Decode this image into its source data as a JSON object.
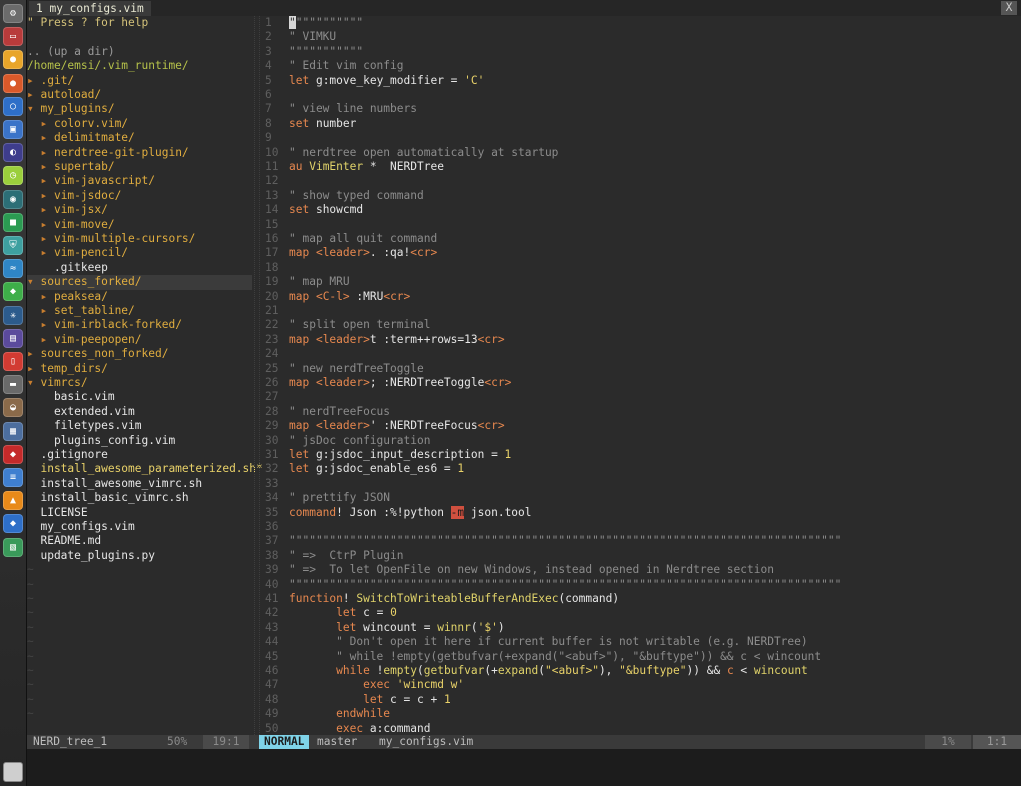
{
  "tab": {
    "label": "1  my_configs.vim",
    "close": "X"
  },
  "dock": {
    "items": [
      {
        "icon": "system-settings-icon",
        "color": "#6b6b6b",
        "glyph": "⚙"
      },
      {
        "icon": "terminal-icon",
        "color": "#b83b3b",
        "glyph": "▭"
      },
      {
        "icon": "chrome-icon",
        "color": "#e8a52a",
        "glyph": "●"
      },
      {
        "icon": "firefox-icon",
        "color": "#d9592a",
        "glyph": "●"
      },
      {
        "icon": "browser-icon",
        "color": "#2e6fc8",
        "glyph": "○"
      },
      {
        "icon": "network-icon",
        "color": "#3a73c8",
        "glyph": "▣"
      },
      {
        "icon": "eclipse-icon",
        "color": "#3e3d8c",
        "glyph": "◐"
      },
      {
        "icon": "clock-icon",
        "color": "#9bcf3c",
        "glyph": "◷"
      },
      {
        "icon": "camera-icon",
        "color": "#2c6e76",
        "glyph": "◉"
      },
      {
        "icon": "app-green-icon",
        "color": "#2b9b52",
        "glyph": "■"
      },
      {
        "icon": "shield-icon",
        "color": "#3ea0a0",
        "glyph": "⛨"
      },
      {
        "icon": "fish-icon",
        "color": "#2f86c6",
        "glyph": "≈"
      },
      {
        "icon": "android-icon",
        "color": "#3eae49",
        "glyph": "◆"
      },
      {
        "icon": "atom-icon",
        "color": "#2c5b8c",
        "glyph": "✳"
      },
      {
        "icon": "server-icon",
        "color": "#5b4a9c",
        "glyph": "▤"
      },
      {
        "icon": "document-icon",
        "color": "#d23b32",
        "glyph": "▯"
      },
      {
        "icon": "drive-icon",
        "color": "#6a6a6a",
        "glyph": "▬"
      },
      {
        "icon": "disk-icon",
        "color": "#8a6a4a",
        "glyph": "◒"
      },
      {
        "icon": "monitor-icon",
        "color": "#4c6e9e",
        "glyph": "▦"
      },
      {
        "icon": "ruby-icon",
        "color": "#c42a2a",
        "glyph": "◆"
      },
      {
        "icon": "text-editor-icon",
        "color": "#3f7fd0",
        "glyph": "≡"
      },
      {
        "icon": "vlc-icon",
        "color": "#e88a1a",
        "glyph": "▲"
      },
      {
        "icon": "vpn-icon",
        "color": "#2e6fc8",
        "glyph": "◆"
      },
      {
        "icon": "image-viewer-icon",
        "color": "#3a9a5a",
        "glyph": "▧"
      }
    ],
    "trash_icon": "trash-icon"
  },
  "tree": [
    {
      "s": [
        {
          "c": "help",
          "t": "\" Press ? for help"
        }
      ]
    },
    {
      "s": []
    },
    {
      "s": [
        {
          "c": "dim",
          "t": ".. (up a dir)"
        }
      ]
    },
    {
      "s": [
        {
          "c": "cwd",
          "t": "/home/emsi/.vim_runtime/"
        }
      ]
    },
    {
      "s": [
        {
          "c": "arrow",
          "t": "▸ "
        },
        {
          "c": "dir",
          "t": ".git/"
        }
      ]
    },
    {
      "s": [
        {
          "c": "arrow",
          "t": "▸ "
        },
        {
          "c": "dir",
          "t": "autoload/"
        }
      ]
    },
    {
      "s": [
        {
          "c": "arrow",
          "t": "▾ "
        },
        {
          "c": "dir",
          "t": "my_plugins/"
        }
      ]
    },
    {
      "s": [
        {
          "c": "arrow",
          "t": "  ▸ "
        },
        {
          "c": "dir",
          "t": "colorv.vim/"
        }
      ]
    },
    {
      "s": [
        {
          "c": "arrow",
          "t": "  ▸ "
        },
        {
          "c": "dir",
          "t": "delimitmate/"
        }
      ]
    },
    {
      "s": [
        {
          "c": "arrow",
          "t": "  ▸ "
        },
        {
          "c": "dir",
          "t": "nerdtree-git-plugin/"
        }
      ]
    },
    {
      "s": [
        {
          "c": "arrow",
          "t": "  ▸ "
        },
        {
          "c": "dir",
          "t": "supertab/"
        }
      ]
    },
    {
      "s": [
        {
          "c": "arrow",
          "t": "  ▸ "
        },
        {
          "c": "dir",
          "t": "vim-javascript/"
        }
      ]
    },
    {
      "s": [
        {
          "c": "arrow",
          "t": "  ▸ "
        },
        {
          "c": "dir",
          "t": "vim-jsdoc/"
        }
      ]
    },
    {
      "s": [
        {
          "c": "arrow",
          "t": "  ▸ "
        },
        {
          "c": "dir",
          "t": "vim-jsx/"
        }
      ]
    },
    {
      "s": [
        {
          "c": "arrow",
          "t": "  ▸ "
        },
        {
          "c": "dir",
          "t": "vim-move/"
        }
      ]
    },
    {
      "s": [
        {
          "c": "arrow",
          "t": "  ▸ "
        },
        {
          "c": "dir",
          "t": "vim-multiple-cursors/"
        }
      ]
    },
    {
      "s": [
        {
          "c": "arrow",
          "t": "  ▸ "
        },
        {
          "c": "dir",
          "t": "vim-pencil/"
        }
      ]
    },
    {
      "s": [
        {
          "c": "file",
          "t": "    .gitkeep"
        }
      ]
    },
    {
      "hl": true,
      "s": [
        {
          "c": "arrow",
          "t": "▾ "
        },
        {
          "c": "dir",
          "t": "sources_forked/"
        }
      ]
    },
    {
      "s": [
        {
          "c": "arrow",
          "t": "  ▸ "
        },
        {
          "c": "dir",
          "t": "peaksea/"
        }
      ]
    },
    {
      "s": [
        {
          "c": "arrow",
          "t": "  ▸ "
        },
        {
          "c": "dir",
          "t": "set_tabline/"
        }
      ]
    },
    {
      "s": [
        {
          "c": "arrow",
          "t": "  ▸ "
        },
        {
          "c": "dir",
          "t": "vim-irblack-forked/"
        }
      ]
    },
    {
      "s": [
        {
          "c": "arrow",
          "t": "  ▸ "
        },
        {
          "c": "dir",
          "t": "vim-peepopen/"
        }
      ]
    },
    {
      "s": [
        {
          "c": "arrow",
          "t": "▸ "
        },
        {
          "c": "dir",
          "t": "sources_non_forked/"
        }
      ]
    },
    {
      "s": [
        {
          "c": "arrow",
          "t": "▸ "
        },
        {
          "c": "dir",
          "t": "temp_dirs/"
        }
      ]
    },
    {
      "s": [
        {
          "c": "arrow",
          "t": "▾ "
        },
        {
          "c": "dir",
          "t": "vimrcs/"
        }
      ]
    },
    {
      "s": [
        {
          "c": "file",
          "t": "    basic.vim"
        }
      ]
    },
    {
      "s": [
        {
          "c": "file",
          "t": "    extended.vim"
        }
      ]
    },
    {
      "s": [
        {
          "c": "file",
          "t": "    filetypes.vim"
        }
      ]
    },
    {
      "s": [
        {
          "c": "file",
          "t": "    plugins_config.vim"
        }
      ]
    },
    {
      "s": [
        {
          "c": "file",
          "t": "  .gitignore"
        }
      ]
    },
    {
      "s": [
        {
          "c": "str",
          "t": "  install_awesome_parameterized.sh*"
        }
      ]
    },
    {
      "s": [
        {
          "c": "file",
          "t": "  install_awesome_vimrc.sh"
        }
      ]
    },
    {
      "s": [
        {
          "c": "file",
          "t": "  install_basic_vimrc.sh"
        }
      ]
    },
    {
      "s": [
        {
          "c": "file",
          "t": "  LICENSE"
        }
      ]
    },
    {
      "s": [
        {
          "c": "file",
          "t": "  my_configs.vim"
        }
      ]
    },
    {
      "s": [
        {
          "c": "file",
          "t": "  README.md"
        }
      ]
    },
    {
      "s": [
        {
          "c": "file",
          "t": "  update_plugins.py"
        }
      ]
    },
    {
      "s": [
        {
          "c": "tilde",
          "t": "~"
        }
      ]
    },
    {
      "s": [
        {
          "c": "tilde",
          "t": "~"
        }
      ]
    },
    {
      "s": [
        {
          "c": "tilde",
          "t": "~"
        }
      ]
    },
    {
      "s": [
        {
          "c": "tilde",
          "t": "~"
        }
      ]
    },
    {
      "s": [
        {
          "c": "tilde",
          "t": "~"
        }
      ]
    },
    {
      "s": [
        {
          "c": "tilde",
          "t": "~"
        }
      ]
    },
    {
      "s": [
        {
          "c": "tilde",
          "t": "~"
        }
      ]
    },
    {
      "s": [
        {
          "c": "tilde",
          "t": "~"
        }
      ]
    },
    {
      "s": [
        {
          "c": "tilde",
          "t": "~"
        }
      ]
    },
    {
      "s": [
        {
          "c": "tilde",
          "t": "~"
        }
      ]
    },
    {
      "s": [
        {
          "c": "tilde",
          "t": "~"
        }
      ]
    }
  ],
  "editor": [
    {
      "n": "1",
      "s": [
        {
          "c": "cursor",
          "t": "\""
        },
        {
          "c": "comment",
          "t": "\"\"\"\"\"\"\"\"\"\""
        }
      ]
    },
    {
      "n": "2",
      "s": [
        {
          "c": "comment",
          "t": "\" VIMKU"
        }
      ]
    },
    {
      "n": "3",
      "s": [
        {
          "c": "comment",
          "t": "\"\"\"\"\"\"\"\"\"\"\""
        }
      ]
    },
    {
      "n": "4",
      "s": [
        {
          "c": "comment",
          "t": "\" Edit vim config"
        }
      ]
    },
    {
      "n": "5",
      "s": [
        {
          "c": "kw",
          "t": "let "
        },
        {
          "c": "id",
          "t": "g:move_key_modifier = "
        },
        {
          "c": "str",
          "t": "'C'"
        }
      ]
    },
    {
      "n": "6",
      "s": []
    },
    {
      "n": "7",
      "s": [
        {
          "c": "comment",
          "t": "\" view line numbers"
        }
      ]
    },
    {
      "n": "8",
      "s": [
        {
          "c": "kw",
          "t": "set "
        },
        {
          "c": "id",
          "t": "number"
        }
      ]
    },
    {
      "n": "9",
      "s": []
    },
    {
      "n": "10",
      "s": [
        {
          "c": "comment",
          "t": "\" nerdtree open automatically at startup"
        }
      ]
    },
    {
      "n": "11",
      "s": [
        {
          "c": "kw",
          "t": "au "
        },
        {
          "c": "cmd",
          "t": "VimEnter"
        },
        {
          "c": "id",
          "t": " *  NERDTree"
        }
      ]
    },
    {
      "n": "12",
      "s": []
    },
    {
      "n": "13",
      "s": [
        {
          "c": "comment",
          "t": "\" show typed command"
        }
      ]
    },
    {
      "n": "14",
      "s": [
        {
          "c": "kw",
          "t": "set "
        },
        {
          "c": "id",
          "t": "showcmd"
        }
      ]
    },
    {
      "n": "15",
      "s": []
    },
    {
      "n": "16",
      "s": [
        {
          "c": "comment",
          "t": "\" map all quit command"
        }
      ]
    },
    {
      "n": "17",
      "s": [
        {
          "c": "kw",
          "t": "map "
        },
        {
          "c": "kw",
          "t": "<leader>"
        },
        {
          "c": "id",
          "t": ". :qa!"
        },
        {
          "c": "kw",
          "t": "<cr>"
        }
      ]
    },
    {
      "n": "18",
      "s": []
    },
    {
      "n": "19",
      "s": [
        {
          "c": "comment",
          "t": "\" map MRU"
        }
      ]
    },
    {
      "n": "20",
      "s": [
        {
          "c": "kw",
          "t": "map "
        },
        {
          "c": "kw",
          "t": "<C-l>"
        },
        {
          "c": "id",
          "t": " :MRU"
        },
        {
          "c": "kw",
          "t": "<cr>"
        }
      ]
    },
    {
      "n": "21",
      "s": []
    },
    {
      "n": "22",
      "s": [
        {
          "c": "comment",
          "t": "\" split open terminal"
        }
      ]
    },
    {
      "n": "23",
      "s": [
        {
          "c": "kw",
          "t": "map "
        },
        {
          "c": "kw",
          "t": "<leader>"
        },
        {
          "c": "id",
          "t": "t :term++rows=13"
        },
        {
          "c": "kw",
          "t": "<cr>"
        }
      ]
    },
    {
      "n": "24",
      "s": []
    },
    {
      "n": "25",
      "s": [
        {
          "c": "comment",
          "t": "\" new nerdTreeToggle"
        }
      ]
    },
    {
      "n": "26",
      "s": [
        {
          "c": "kw",
          "t": "map "
        },
        {
          "c": "kw",
          "t": "<leader>"
        },
        {
          "c": "id",
          "t": "; :NERDTreeToggle"
        },
        {
          "c": "kw",
          "t": "<cr>"
        }
      ]
    },
    {
      "n": "27",
      "s": []
    },
    {
      "n": "28",
      "s": [
        {
          "c": "comment",
          "t": "\" nerdTreeFocus"
        }
      ]
    },
    {
      "n": "29",
      "s": [
        {
          "c": "kw",
          "t": "map "
        },
        {
          "c": "kw",
          "t": "<leader>"
        },
        {
          "c": "id",
          "t": "' :NERDTreeFocus"
        },
        {
          "c": "kw",
          "t": "<cr>"
        }
      ]
    },
    {
      "n": "30",
      "s": [
        {
          "c": "comment",
          "t": "\" jsDoc configuration"
        }
      ]
    },
    {
      "n": "31",
      "s": [
        {
          "c": "kw",
          "t": "let "
        },
        {
          "c": "id",
          "t": "g:jsdoc_input_description = "
        },
        {
          "c": "str",
          "t": "1"
        }
      ]
    },
    {
      "n": "32",
      "s": [
        {
          "c": "kw",
          "t": "let "
        },
        {
          "c": "id",
          "t": "g:jsdoc_enable_es6 = "
        },
        {
          "c": "str",
          "t": "1"
        }
      ]
    },
    {
      "n": "33",
      "s": []
    },
    {
      "n": "34",
      "s": [
        {
          "c": "comment",
          "t": "\" prettify JSON"
        }
      ]
    },
    {
      "n": "35",
      "s": [
        {
          "c": "kw",
          "t": "command"
        },
        {
          "c": "id",
          "t": "! Json :%!python "
        },
        {
          "c": "err",
          "t": "-m"
        },
        {
          "c": "id",
          "t": " json.tool"
        }
      ]
    },
    {
      "n": "36",
      "s": []
    },
    {
      "n": "37",
      "s": [
        {
          "c": "sep",
          "t": "\"\"\"\"\"\"\"\"\"\"\"\"\"\"\"\"\"\"\"\"\"\"\"\"\"\"\"\"\"\"\"\"\"\"\"\"\"\"\"\"\"\"\"\"\"\"\"\"\"\"\"\"\"\"\"\"\"\"\"\"\"\"\"\"\"\"\"\"\"\"\"\"\"\"\"\"\"\"\"\"\"\""
        }
      ]
    },
    {
      "n": "38",
      "s": [
        {
          "c": "comment",
          "t": "\" =>  CtrP Plugin"
        }
      ]
    },
    {
      "n": "39",
      "s": [
        {
          "c": "comment",
          "t": "\" =>  To let OpenFile on new Windows, instead opened in Nerdtree section"
        }
      ]
    },
    {
      "n": "40",
      "s": [
        {
          "c": "sep",
          "t": "\"\"\"\"\"\"\"\"\"\"\"\"\"\"\"\"\"\"\"\"\"\"\"\"\"\"\"\"\"\"\"\"\"\"\"\"\"\"\"\"\"\"\"\"\"\"\"\"\"\"\"\"\"\"\"\"\"\"\"\"\"\"\"\"\"\"\"\"\"\"\"\"\"\"\"\"\"\"\"\"\"\""
        }
      ]
    },
    {
      "n": "41",
      "s": [
        {
          "c": "kw",
          "t": "function"
        },
        {
          "c": "id",
          "t": "! "
        },
        {
          "c": "cmd",
          "t": "SwitchToWriteableBufferAndExec"
        },
        {
          "c": "id",
          "t": "(command)"
        }
      ]
    },
    {
      "n": "42",
      "s": [
        {
          "c": "id",
          "t": "       "
        },
        {
          "c": "kw",
          "t": "let "
        },
        {
          "c": "id",
          "t": "c = "
        },
        {
          "c": "str",
          "t": "0"
        }
      ]
    },
    {
      "n": "43",
      "s": [
        {
          "c": "id",
          "t": "       "
        },
        {
          "c": "kw",
          "t": "let "
        },
        {
          "c": "id",
          "t": "wincount = "
        },
        {
          "c": "cmd",
          "t": "winnr"
        },
        {
          "c": "id",
          "t": "("
        },
        {
          "c": "str",
          "t": "'$'"
        },
        {
          "c": "id",
          "t": ")"
        }
      ]
    },
    {
      "n": "44",
      "s": [
        {
          "c": "comment",
          "t": "       \" Don't open it here if current buffer is not writable (e.g. NERDTree)"
        }
      ]
    },
    {
      "n": "45",
      "s": [
        {
          "c": "comment",
          "t": "       \" while !empty(getbufvar(+expand(\"<abuf>\"), \"&buftype\")) && c < wincount"
        }
      ]
    },
    {
      "n": "46",
      "s": [
        {
          "c": "id",
          "t": "       "
        },
        {
          "c": "kw",
          "t": "while "
        },
        {
          "c": "id",
          "t": "!"
        },
        {
          "c": "cmd",
          "t": "empty"
        },
        {
          "c": "id",
          "t": "("
        },
        {
          "c": "cmd",
          "t": "getbufvar"
        },
        {
          "c": "id",
          "t": "(+"
        },
        {
          "c": "cmd",
          "t": "expand"
        },
        {
          "c": "id",
          "t": "("
        },
        {
          "c": "str",
          "t": "\"<abuf>\""
        },
        {
          "c": "id",
          "t": "), "
        },
        {
          "c": "str",
          "t": "\"&buftype\""
        },
        {
          "c": "id",
          "t": ")) && "
        },
        {
          "c": "kw",
          "t": "c"
        },
        {
          "c": "id",
          "t": " < "
        },
        {
          "c": "cmd",
          "t": "wincount"
        }
      ]
    },
    {
      "n": "47",
      "s": [
        {
          "c": "id",
          "t": "           "
        },
        {
          "c": "kw",
          "t": "exec "
        },
        {
          "c": "str",
          "t": "'wincmd w'"
        }
      ]
    },
    {
      "n": "48",
      "s": [
        {
          "c": "id",
          "t": "           "
        },
        {
          "c": "kw",
          "t": "let "
        },
        {
          "c": "id",
          "t": "c = c + "
        },
        {
          "c": "str",
          "t": "1"
        }
      ]
    },
    {
      "n": "49",
      "s": [
        {
          "c": "id",
          "t": "       "
        },
        {
          "c": "kw",
          "t": "endwhile"
        }
      ]
    },
    {
      "n": "50",
      "s": [
        {
          "c": "id",
          "t": "       "
        },
        {
          "c": "kw",
          "t": "exec "
        },
        {
          "c": "id",
          "t": "a:command"
        }
      ]
    }
  ],
  "statusline": {
    "left_name": "NERD_tree_1",
    "left_percent": "50%",
    "left_position": "19:1",
    "mode": "NORMAL",
    "branch": "master",
    "file": "my_configs.vim",
    "percent": "1%",
    "position": "1:1"
  },
  "colors": {
    "mode_bg": "#7fd3e8",
    "background": "#2b2b2b",
    "keyword": "#e7884f",
    "string": "#e9d269",
    "comment": "#8c8c8c"
  }
}
